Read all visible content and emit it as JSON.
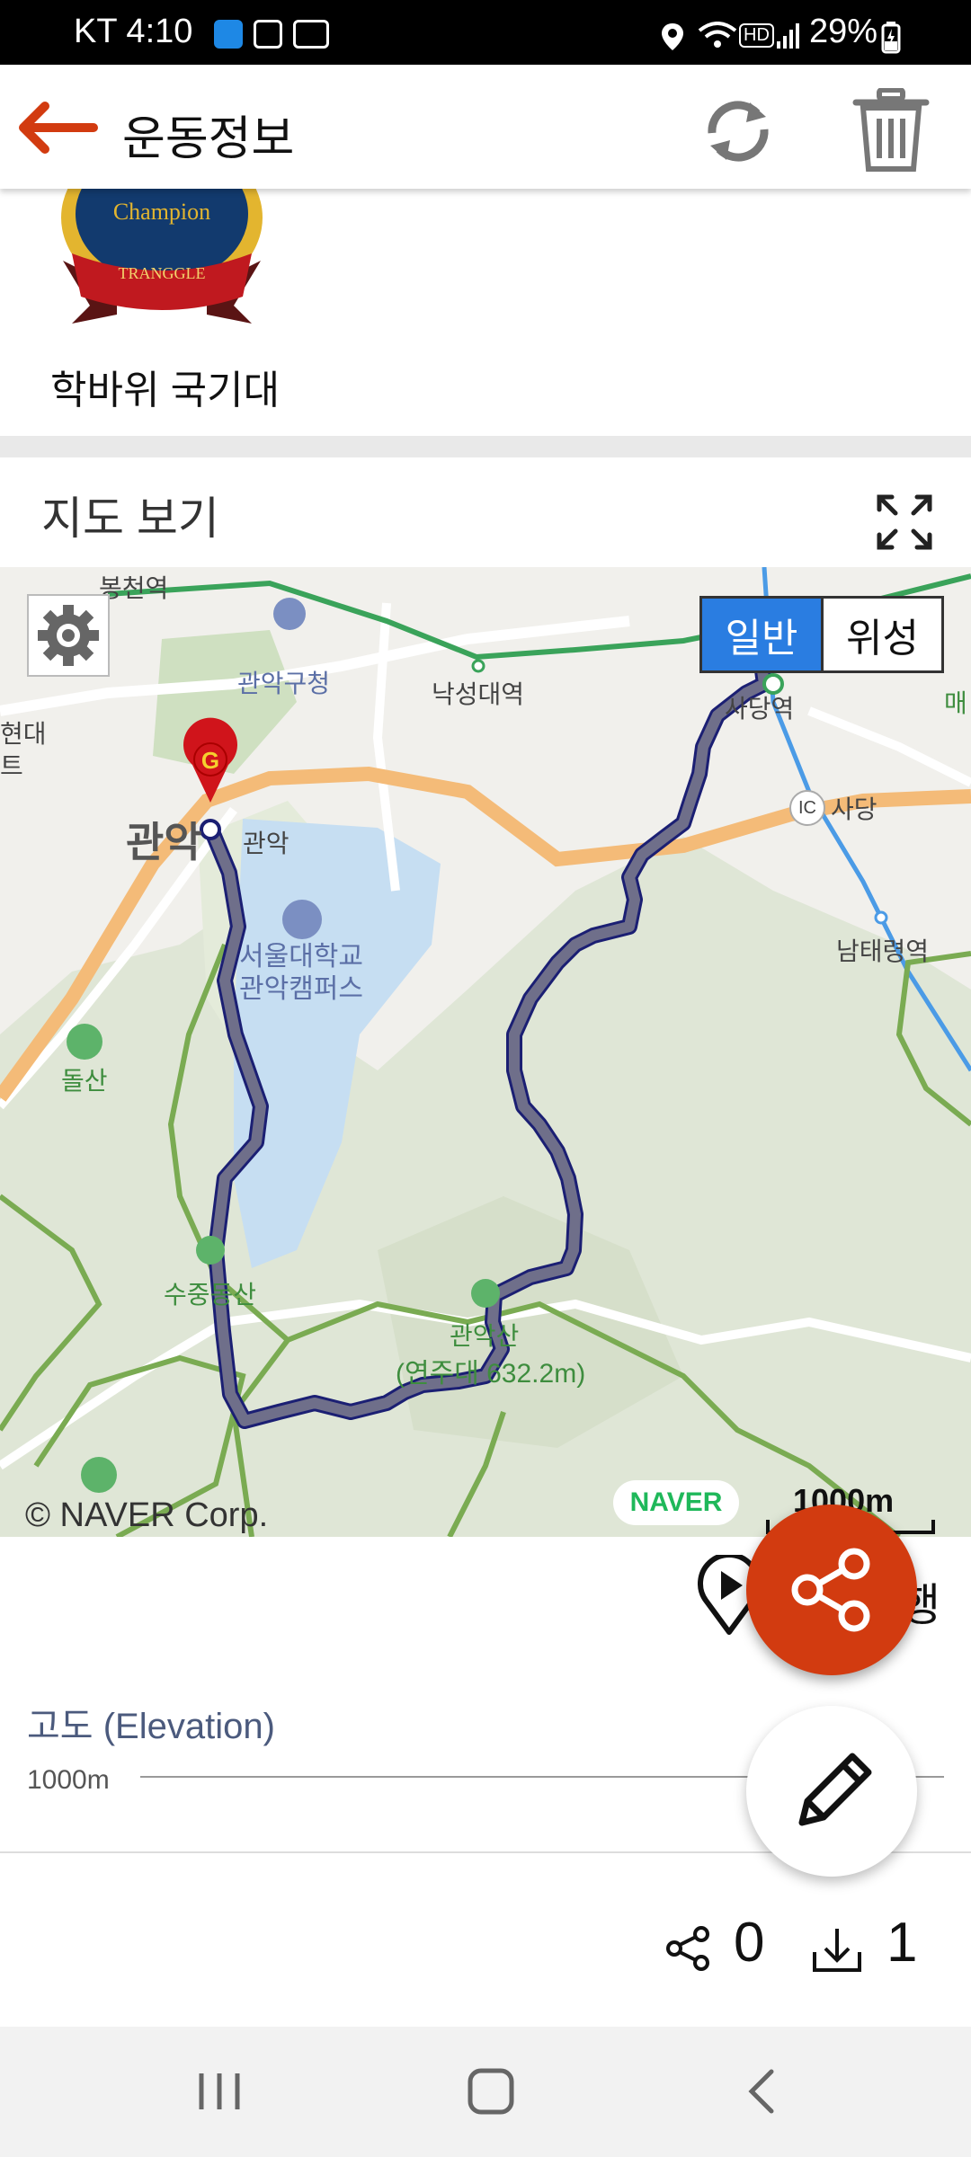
{
  "status_bar": {
    "carrier_time": "KT 4:10",
    "battery": "29%",
    "hd_label": "HD"
  },
  "app_bar": {
    "title": "운동정보"
  },
  "badge": {
    "image_text_top": "Champion",
    "image_text_ribbon": "TRANGGLE",
    "name": "학바위 국기대"
  },
  "map_section": {
    "title": "지도 보기",
    "map_type": {
      "normal": "일반",
      "satellite": "위성",
      "selected": "일반"
    },
    "labels": {
      "bongcheon": "봉천역",
      "gwanak_office": "관악구청",
      "nakseongdae": "낙성대역",
      "sadang_station": "사당역",
      "sadang": "사당",
      "ic": "IC",
      "namtaeryeong": "남태령역",
      "gwanak_big": "관악",
      "gwanak_small": "관악",
      "snu": "서울대학교\n관악캠퍼스",
      "dolsan": "돌산",
      "sujeongdongsan": "수중동산",
      "gwanaksan": "관악산",
      "yeonjudae": "(연주대 632.2m)",
      "left_edge_1": "현대",
      "left_edge_2": "트",
      "right_edge": "매"
    },
    "marker_letter": "G",
    "copyright": "© NAVER Corp.",
    "naver_logo": "NAVER",
    "scale": "1000m"
  },
  "playback": {
    "label": "행"
  },
  "elevation": {
    "title": "고도 (Elevation)",
    "tick": "1000m"
  },
  "stats": {
    "shares": "0",
    "downloads": "1"
  },
  "colors": {
    "accent": "#d23b10",
    "map_toggle_active": "#2a7de1",
    "route": "#6f6f8a"
  }
}
